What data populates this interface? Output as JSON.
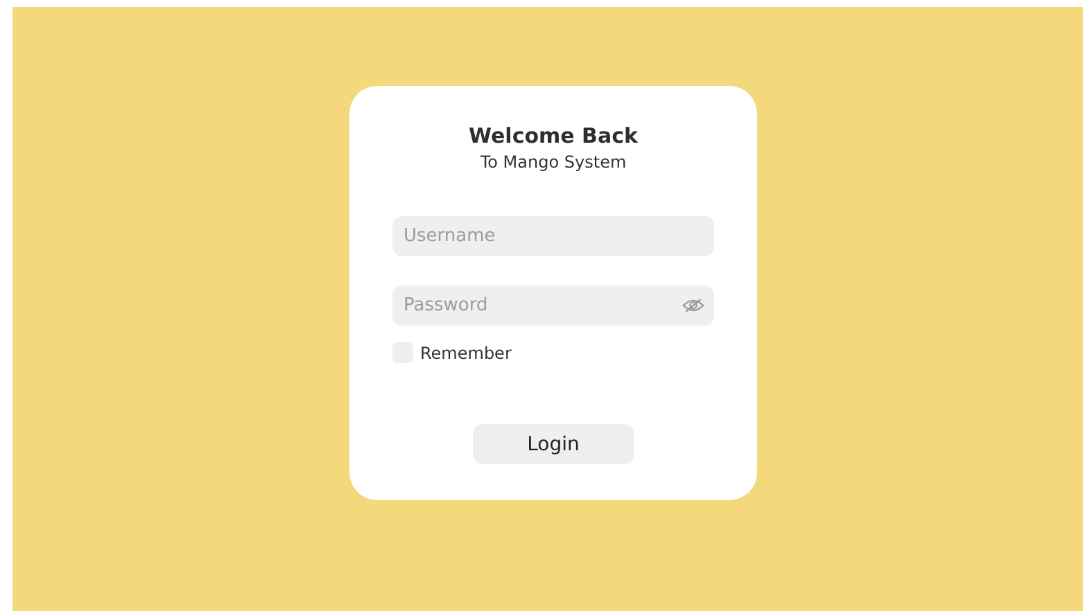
{
  "login_card": {
    "title": "Welcome Back",
    "subtitle": "To Mango System",
    "username": {
      "placeholder": "Username"
    },
    "password": {
      "placeholder": "Password",
      "revealed": false
    },
    "remember": {
      "label": "Remember",
      "checked": false
    },
    "button": "Login"
  }
}
